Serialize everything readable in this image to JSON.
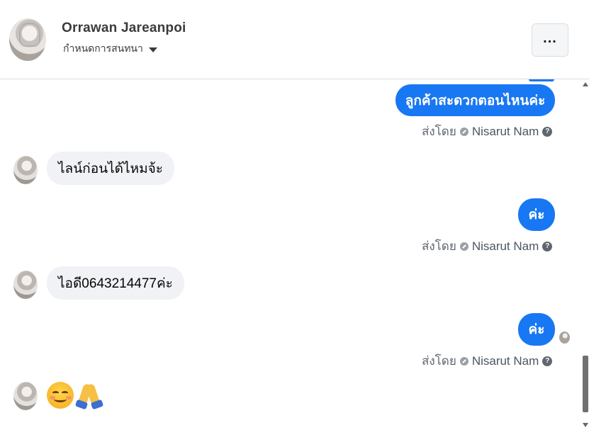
{
  "header": {
    "contact_name": "Orrawan Jareanpoi",
    "assign_label": "กำหนดการสนทนา",
    "more_label": "..."
  },
  "messages": [
    {
      "direction": "outgoing",
      "text": "ลูกค้าสะดวกตอนไหนค่ะ"
    },
    {
      "direction": "incoming",
      "text": "ไลน์ก่อนได้ไหมจ้ะ"
    },
    {
      "direction": "outgoing",
      "text": "ค่ะ"
    },
    {
      "direction": "incoming",
      "text": "ไอดี0643214477ค่ะ"
    },
    {
      "direction": "outgoing",
      "text": "ค่ะ"
    },
    {
      "direction": "incoming",
      "text": "😊🙏"
    }
  ],
  "sent_by": {
    "prefix": "ส่งโดย",
    "agent_name": "Nisarut Nam",
    "help": "?"
  },
  "colors": {
    "outgoing_bubble": "#1877f2",
    "incoming_bubble": "#f0f2f5"
  }
}
